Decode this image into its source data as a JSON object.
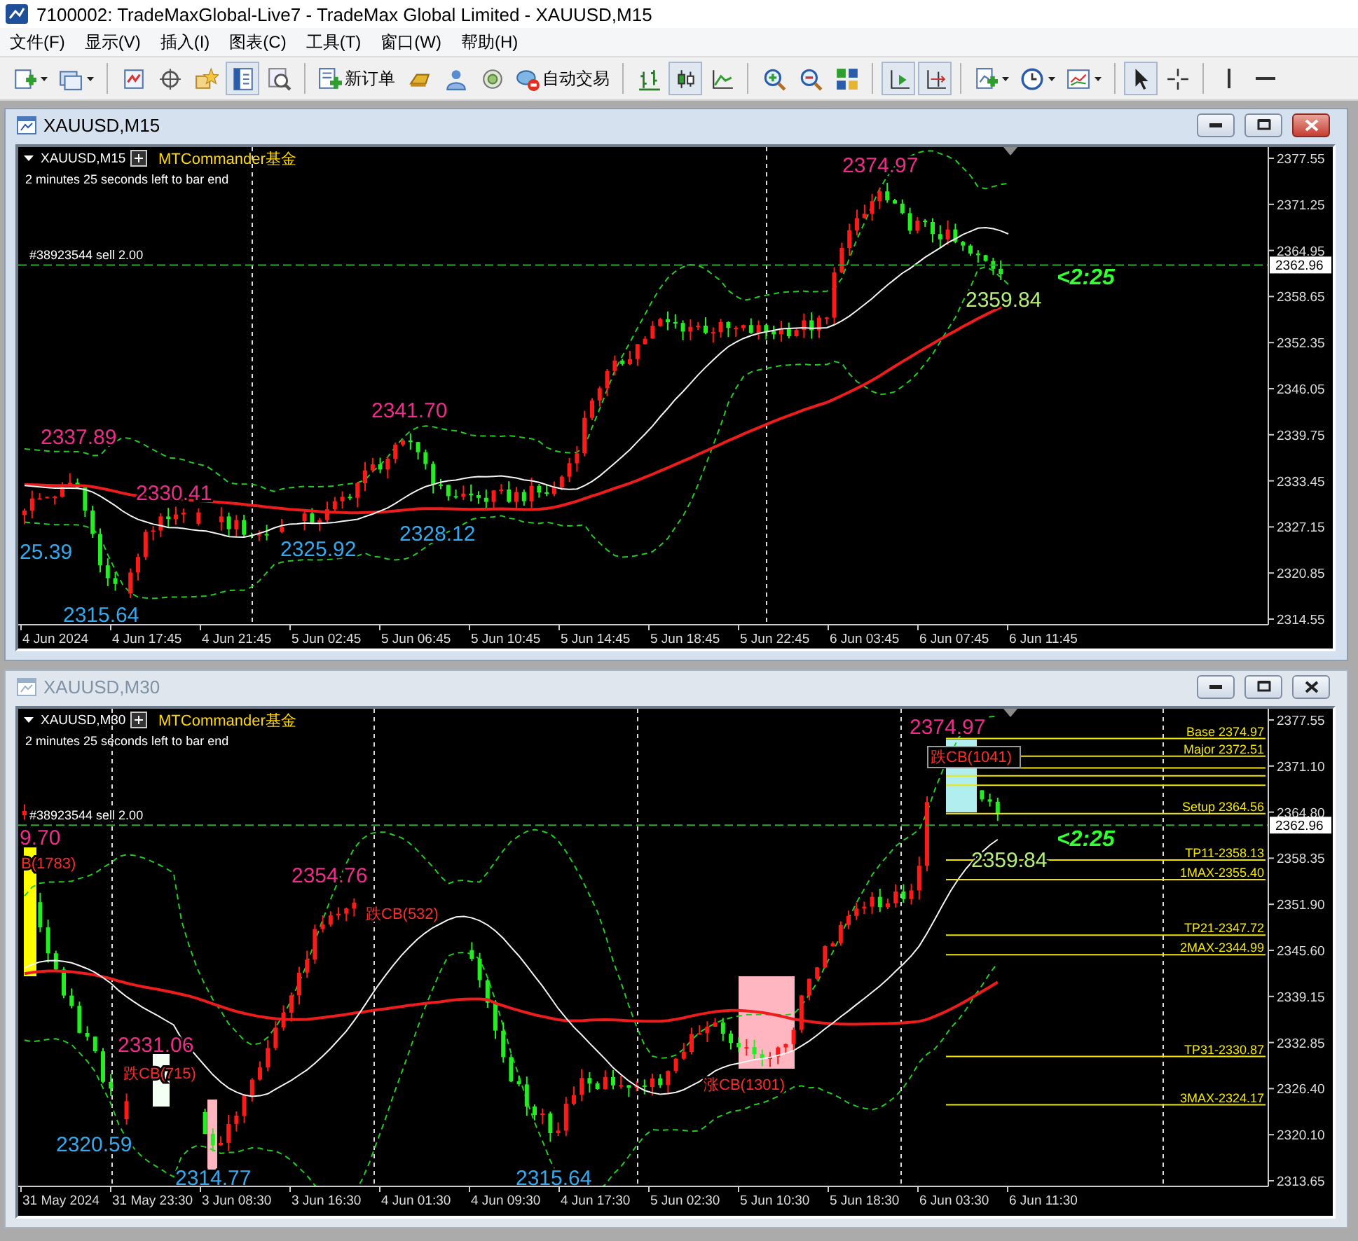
{
  "window": {
    "title": "7100002: TradeMaxGlobal-Live7 - TradeMax Global Limited - XAUUSD,M15"
  },
  "menu": [
    {
      "label": "文件(F)"
    },
    {
      "label": "显示(V)"
    },
    {
      "label": "插入(I)"
    },
    {
      "label": "图表(C)"
    },
    {
      "label": "工具(T)"
    },
    {
      "label": "窗口(W)"
    },
    {
      "label": "帮助(H)"
    }
  ],
  "toolbar": [
    {
      "kind": "icon",
      "pressed": false
    },
    {
      "kind": "icon",
      "pressed": false
    },
    {
      "kind": "separator"
    },
    {
      "kind": "icon",
      "pressed": false
    },
    {
      "kind": "icon",
      "pressed": false
    },
    {
      "kind": "icon",
      "pressed": false
    },
    {
      "kind": "icon",
      "pressed": true
    },
    {
      "kind": "icon",
      "pressed": false
    },
    {
      "kind": "separator"
    },
    {
      "kind": "button",
      "label": "新订单"
    },
    {
      "kind": "icon",
      "pressed": false
    },
    {
      "kind": "icon",
      "pressed": false
    },
    {
      "kind": "icon",
      "pressed": false
    },
    {
      "kind": "button",
      "label": "自动交易"
    },
    {
      "kind": "separator"
    },
    {
      "kind": "icon",
      "pressed": false
    },
    {
      "kind": "icon",
      "pressed": true
    },
    {
      "kind": "icon",
      "pressed": false
    },
    {
      "kind": "separator"
    },
    {
      "kind": "icon",
      "pressed": false
    },
    {
      "kind": "icon",
      "pressed": false
    },
    {
      "kind": "icon",
      "pressed": false
    },
    {
      "kind": "separator"
    },
    {
      "kind": "icon",
      "pressed": true
    },
    {
      "kind": "icon",
      "pressed": true
    },
    {
      "kind": "separator"
    },
    {
      "kind": "icon",
      "pressed": false
    },
    {
      "kind": "icon",
      "pressed": false
    },
    {
      "kind": "icon",
      "pressed": false
    },
    {
      "kind": "separator"
    },
    {
      "kind": "icon",
      "pressed": true
    },
    {
      "kind": "icon",
      "pressed": false
    },
    {
      "kind": "separator"
    },
    {
      "kind": "icon",
      "pressed": false
    },
    {
      "kind": "icon",
      "pressed": false
    }
  ],
  "charts": [
    {
      "title": "XAUUSD,M15",
      "active": true,
      "symbol": "XAUUSD,M15",
      "indicator": "MTCommander基金",
      "timer": "2 minutes 25 seconds left to bar end",
      "order": "#38923544 sell 2.00",
      "current_price": "2362.96",
      "price_ticks": [
        "2377.55",
        "2371.25",
        "2364.95",
        "2358.65",
        "2352.35",
        "2346.05",
        "2339.75",
        "2333.45",
        "2327.15",
        "2320.85",
        "2314.55"
      ],
      "time_ticks": [
        "4 Jun 2024",
        "4 Jun 17:45",
        "4 Jun 21:45",
        "5 Jun 02:45",
        "5 Jun 06:45",
        "5 Jun 10:45",
        "5 Jun 14:45",
        "5 Jun 18:45",
        "5 Jun 22:45",
        "6 Jun 03:45",
        "6 Jun 07:45",
        "6 Jun 11:45"
      ],
      "annotations": [
        {
          "text": "2374.97",
          "kind": "high"
        },
        {
          "text": "2359.84",
          "kind": "last"
        },
        {
          "text": "<2:25",
          "kind": "countdown"
        },
        {
          "text": "2341.70",
          "kind": "high"
        },
        {
          "text": "2337.89",
          "kind": "high"
        },
        {
          "text": "2330.41",
          "kind": "high"
        },
        {
          "text": "2328.12",
          "kind": "low"
        },
        {
          "text": "2325.92",
          "kind": "low"
        },
        {
          "text": "25.39",
          "kind": "low"
        },
        {
          "text": "2315.64",
          "kind": "low"
        }
      ]
    },
    {
      "title": "XAUUSD,M30",
      "active": false,
      "symbol": "XAUUSD,M30",
      "indicator": "MTCommander基金",
      "timer": "2 minutes 25 seconds left to bar end",
      "order": "#38923544 sell 2.00",
      "current_price": "2362.96",
      "price_ticks": [
        "2377.55",
        "2371.10",
        "2364.80",
        "2358.35",
        "2351.90",
        "2345.60",
        "2339.15",
        "2332.85",
        "2326.40",
        "2320.10",
        "2313.65"
      ],
      "time_ticks": [
        "31 May 2024",
        "31 May 23:30",
        "3 Jun 08:30",
        "3 Jun 16:30",
        "4 Jun 01:30",
        "4 Jun 09:30",
        "4 Jun 17:30",
        "5 Jun 02:30",
        "5 Jun 10:30",
        "5 Jun 18:30",
        "6 Jun 03:30",
        "6 Jun 11:30"
      ],
      "annotations": [
        {
          "text": "2374.97",
          "kind": "high"
        },
        {
          "text": "2359.84",
          "kind": "last"
        },
        {
          "text": "<2:25",
          "kind": "countdown"
        },
        {
          "text": "9.70",
          "kind": "high"
        },
        {
          "text": "B(1783)",
          "kind": "signal"
        },
        {
          "text": "2354.76",
          "kind": "high"
        },
        {
          "text": "跌CB(532)",
          "kind": "signal"
        },
        {
          "text": "2331.06",
          "kind": "high"
        },
        {
          "text": "跌CB(715)",
          "kind": "signal"
        },
        {
          "text": "2320.59",
          "kind": "low"
        },
        {
          "text": "2314.77",
          "kind": "low"
        },
        {
          "text": "2315.64",
          "kind": "low"
        },
        {
          "text": "涨CB(1301)",
          "kind": "signal"
        },
        {
          "text": "跌CB(1041)",
          "kind": "signal-boxed"
        }
      ],
      "levels": [
        {
          "text": "Base 2374.97"
        },
        {
          "text": "Major 2372.51"
        },
        {
          "text": "Setup 2364.56"
        },
        {
          "text": "TP11-2358.13"
        },
        {
          "text": "1MAX-2355.40"
        },
        {
          "text": "TP21-2347.72"
        },
        {
          "text": "2MAX-2344.99"
        },
        {
          "text": "TP31-2330.87"
        },
        {
          "text": "3MAX-2324.17"
        }
      ]
    }
  ]
}
